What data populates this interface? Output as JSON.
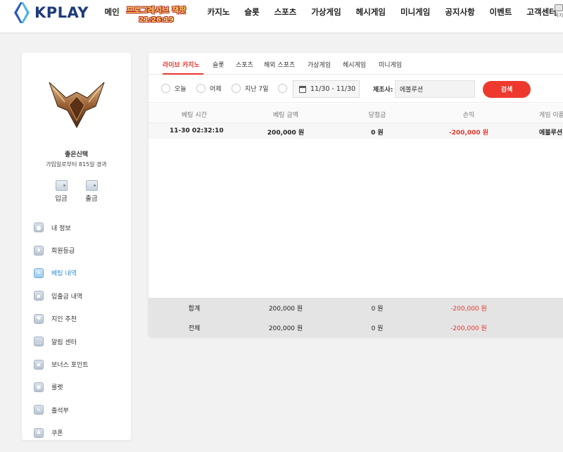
{
  "header": {
    "brand": "KPLAY",
    "nav": [
      "메인",
      "카지노",
      "슬롯",
      "스포츠",
      "가상게임",
      "헤시게임",
      "미니게임",
      "공지사항",
      "이벤트",
      "고객센터"
    ],
    "promo_line1": "프로그레시브 잭팟",
    "promo_line2": "21:26:19",
    "right_label": "쪽지"
  },
  "sidebar": {
    "username": "좋은신택",
    "join_days": "가입일로부터 815일 경과",
    "deposit": "입금",
    "withdraw": "출금",
    "menu": [
      {
        "label": "내 정보",
        "icon": "user-icon"
      },
      {
        "label": "회원등급",
        "icon": "shield-icon"
      },
      {
        "label": "베팅 내역",
        "icon": "edit-icon",
        "active": true
      },
      {
        "label": "입출금 내역",
        "icon": "wallet-icon"
      },
      {
        "label": "지인 추천",
        "icon": "heart-icon"
      },
      {
        "label": "알림 센터",
        "icon": "chat-icon"
      },
      {
        "label": "보너스 포인트",
        "icon": "wallet-icon"
      },
      {
        "label": "룰렛",
        "icon": "target-icon"
      },
      {
        "label": "출석부",
        "icon": "edit-icon"
      },
      {
        "label": "쿠폰",
        "icon": "coupon-icon"
      }
    ]
  },
  "tabs": [
    "라이브 카지노",
    "슬롯",
    "스포츠",
    "해외 스포츠",
    "가상게임",
    "헤시게임",
    "미니게임"
  ],
  "filter": {
    "today": "오늘",
    "yesterday": "어제",
    "last7": "지난 7일",
    "date_range": "11/30 - 11/30",
    "provider_label": "제조사:",
    "provider_value": "에볼루션",
    "search": "검색"
  },
  "table": {
    "headers": [
      "베팅 시간",
      "베팅 금액",
      "당첨금",
      "손익",
      "게임 이름"
    ],
    "row": {
      "time": "11-30 02:32:10",
      "bet": "200,000 원",
      "win": "0 원",
      "profit": "-200,000 원",
      "game": "에볼루션"
    },
    "subtotal": {
      "label": "합계",
      "bet": "200,000 원",
      "win": "0 원",
      "profit": "-200,000 원"
    },
    "total": {
      "label": "전체",
      "bet": "200,000 원",
      "win": "0 원",
      "profit": "-200,000 원"
    }
  },
  "colors": {
    "accent": "#ee3a2e",
    "active_menu": "#2a8ed6",
    "brand": "#1f3b7a"
  }
}
